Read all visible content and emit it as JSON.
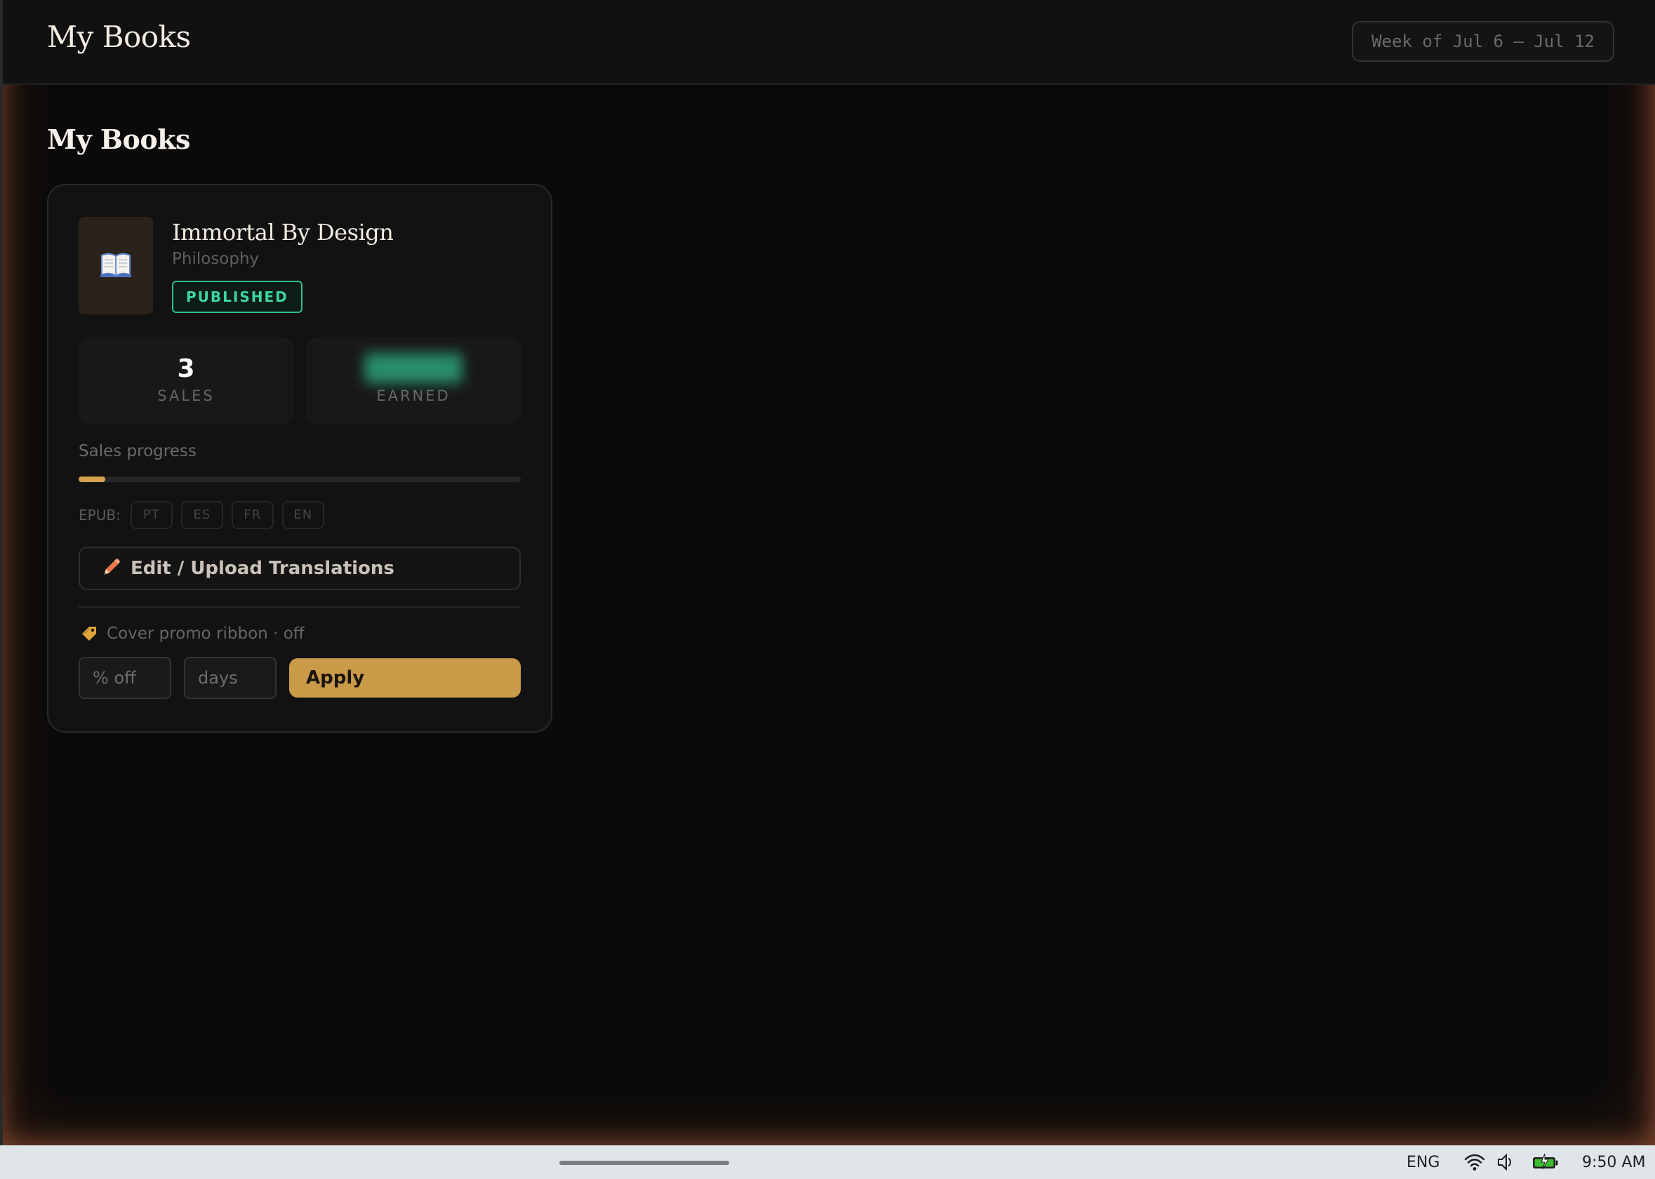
{
  "header": {
    "app_title": "My Books",
    "week_label": "Week of Jul 6 – Jul 12"
  },
  "main": {
    "section_title": "My Books"
  },
  "book": {
    "cover_icon": "open-book-icon",
    "title": "Immortal By Design",
    "category": "Philosophy",
    "status": "PUBLISHED",
    "status_color": "#3ed6a0",
    "stats": {
      "sales_value": "3",
      "sales_label": "SALES",
      "earned_label": "EARNED"
    },
    "progress": {
      "label": "Sales progress",
      "fraction": 0.06,
      "color": "#d4a24c"
    },
    "epub": {
      "label": "EPUB:",
      "languages": [
        "PT",
        "ES",
        "FR",
        "EN"
      ]
    },
    "edit_button_label": "Edit / Upload Translations",
    "promo": {
      "label": "Cover promo ribbon · off",
      "percent_placeholder": "% off",
      "days_placeholder": "days",
      "apply_label": "Apply",
      "accent_color": "#c99a48"
    }
  },
  "taskbar": {
    "language": "ENG",
    "time": "9:50 AM",
    "icons": [
      "wifi-icon",
      "volume-icon",
      "battery-icon"
    ]
  }
}
